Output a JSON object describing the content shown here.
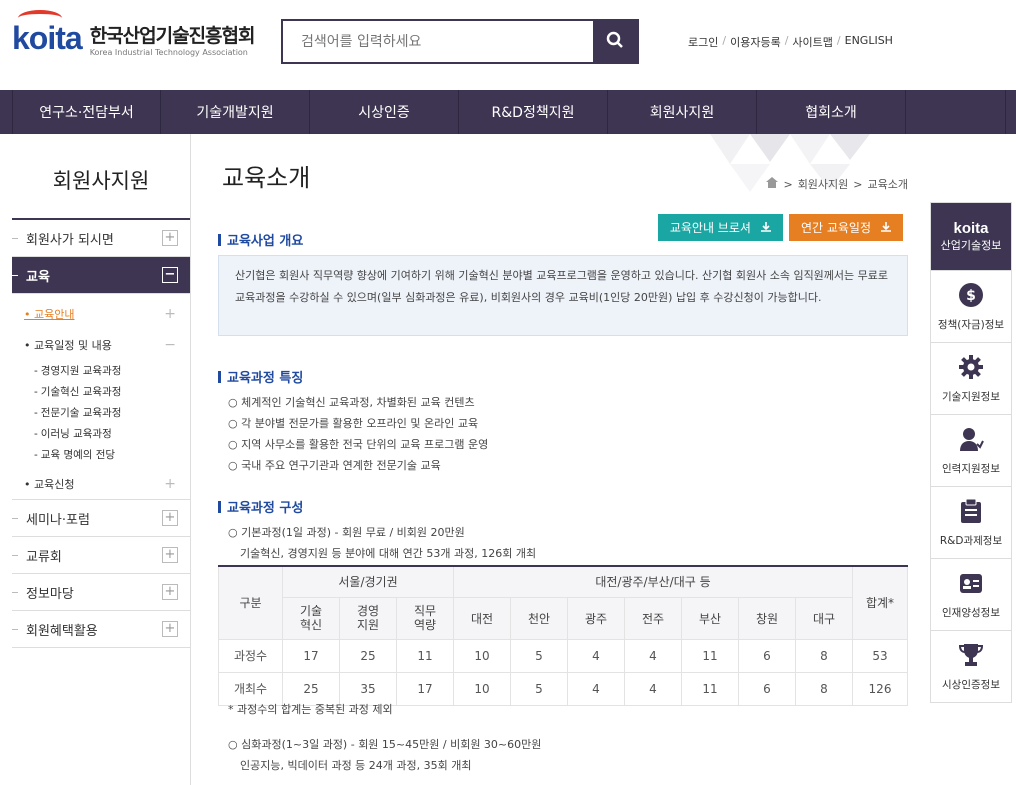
{
  "header": {
    "logo_mark": "koita",
    "logo_ko": "한국산업기술진흥협회",
    "logo_en": "Korea Industrial Technology Association",
    "search_placeholder": "검색어를 입력하세요",
    "search_icon": "search-icon",
    "util_links": [
      "로그인",
      "이용자등록",
      "사이트맵",
      "ENGLISH"
    ]
  },
  "gnb": [
    "연구소·전담부서",
    "기술개발지원",
    "시상인증",
    "R&D정책지원",
    "회원사지원",
    "협회소개"
  ],
  "lnb": {
    "title": "회원사지원",
    "top": [
      {
        "label": "회원사가 되시면",
        "sign": "+"
      }
    ],
    "active": {
      "label": "교육",
      "sign": "−"
    },
    "sub": [
      {
        "label": "교육안내",
        "sign": "+"
      },
      {
        "label": "교육일정 및 내용",
        "sign": "−"
      }
    ],
    "subsub": [
      "경영지원 교육과정",
      "기술혁신 교육과정",
      "전문기술 교육과정",
      "이러닝 교육과정",
      "교육 명예의 전당"
    ],
    "sub_last": {
      "label": "교육신청",
      "sign": "+"
    },
    "bottom": [
      {
        "label": "세미나·포럼",
        "sign": "+"
      },
      {
        "label": "교류회",
        "sign": "+"
      },
      {
        "label": "정보마당",
        "sign": "+"
      },
      {
        "label": "회원혜택활용",
        "sign": "+"
      }
    ]
  },
  "content": {
    "title": "교육소개",
    "breadcrumb": [
      "회원사지원",
      "교육소개"
    ],
    "breadcrumb_sep": ">",
    "buttons": {
      "brochure": "교육안내 브로셔",
      "schedule": "연간 교육일정"
    },
    "sec1": "교육사업 개요",
    "overview": "산기협은 회원사 직무역량 향상에 기여하기 위해 기술혁신 분야별 교육프로그램을 운영하고 있습니다. 산기협 회원사 소속 임직원께서는 무료로 교육과정을 수강하실 수 있으며(일부 심화과정은 유료), 비회원사의 경우 교육비(1인당 20만원) 납입 후 수강신청이 가능합니다.",
    "sec2": "교육과정 특징",
    "features": [
      "체계적인 기술혁신 교육과정, 차별화된 교육 컨텐츠",
      "각 분야별 전문가를 활용한 오프라인 및 온라인 교육",
      "지역 사무소를 활용한 전국 단위의 교육 프로그램 운영",
      "국내 주요 연구기관과 연계한 전문기술 교육"
    ],
    "sec3": "교육과정 구성",
    "basic_line1": "○ 기본과정(1일 과정) - 회원 무료 / 비회원 20만원",
    "basic_line2": "기술혁신, 경영지원 등 분야에 대해 연간 53개 과정, 126회 개최",
    "table": {
      "gubun": "구분",
      "seoul": "서울/경기권",
      "regional": "대전/광주/부산/대구 등",
      "total": "합계*",
      "sub_seoul": [
        [
          "기술",
          "혁신"
        ],
        [
          "경영",
          "지원"
        ],
        [
          "직무",
          "역량"
        ]
      ],
      "sub_regional": [
        "대전",
        "천안",
        "광주",
        "전주",
        "부산",
        "창원",
        "대구"
      ],
      "rows": [
        {
          "label": "과정수",
          "values": [
            "17",
            "25",
            "11",
            "10",
            "5",
            "4",
            "4",
            "11",
            "6",
            "8",
            "53"
          ]
        },
        {
          "label": "개최수",
          "values": [
            "25",
            "35",
            "17",
            "10",
            "5",
            "4",
            "4",
            "11",
            "6",
            "8",
            "126"
          ]
        }
      ]
    },
    "note": "* 과정수의 합계는 중복된 과정 제외",
    "adv_line1": "○ 심화과정(1~3일 과정) - 회원 15~45만원 / 비회원 30~60만원",
    "adv_line2": "인공지능, 빅데이터 과정 등 24개 과정, 35회 개최"
  },
  "quick": {
    "logo": "koita",
    "head": "산업기술정보",
    "items": [
      {
        "label": "정책(자금)정보",
        "icon": "dollar-icon"
      },
      {
        "label": "기술지원정보",
        "icon": "gear-icon"
      },
      {
        "label": "인력지원정보",
        "icon": "person-icon"
      },
      {
        "label": "R&D과제정보",
        "icon": "clipboard-icon"
      },
      {
        "label": "인재양성정보",
        "icon": "id-card-icon"
      },
      {
        "label": "시상인증정보",
        "icon": "trophy-icon"
      }
    ]
  },
  "colors": {
    "brand": "#3e3552",
    "accent_blue": "#1f4aa0",
    "teal": "#1aa7a4",
    "orange": "#e67e22"
  }
}
